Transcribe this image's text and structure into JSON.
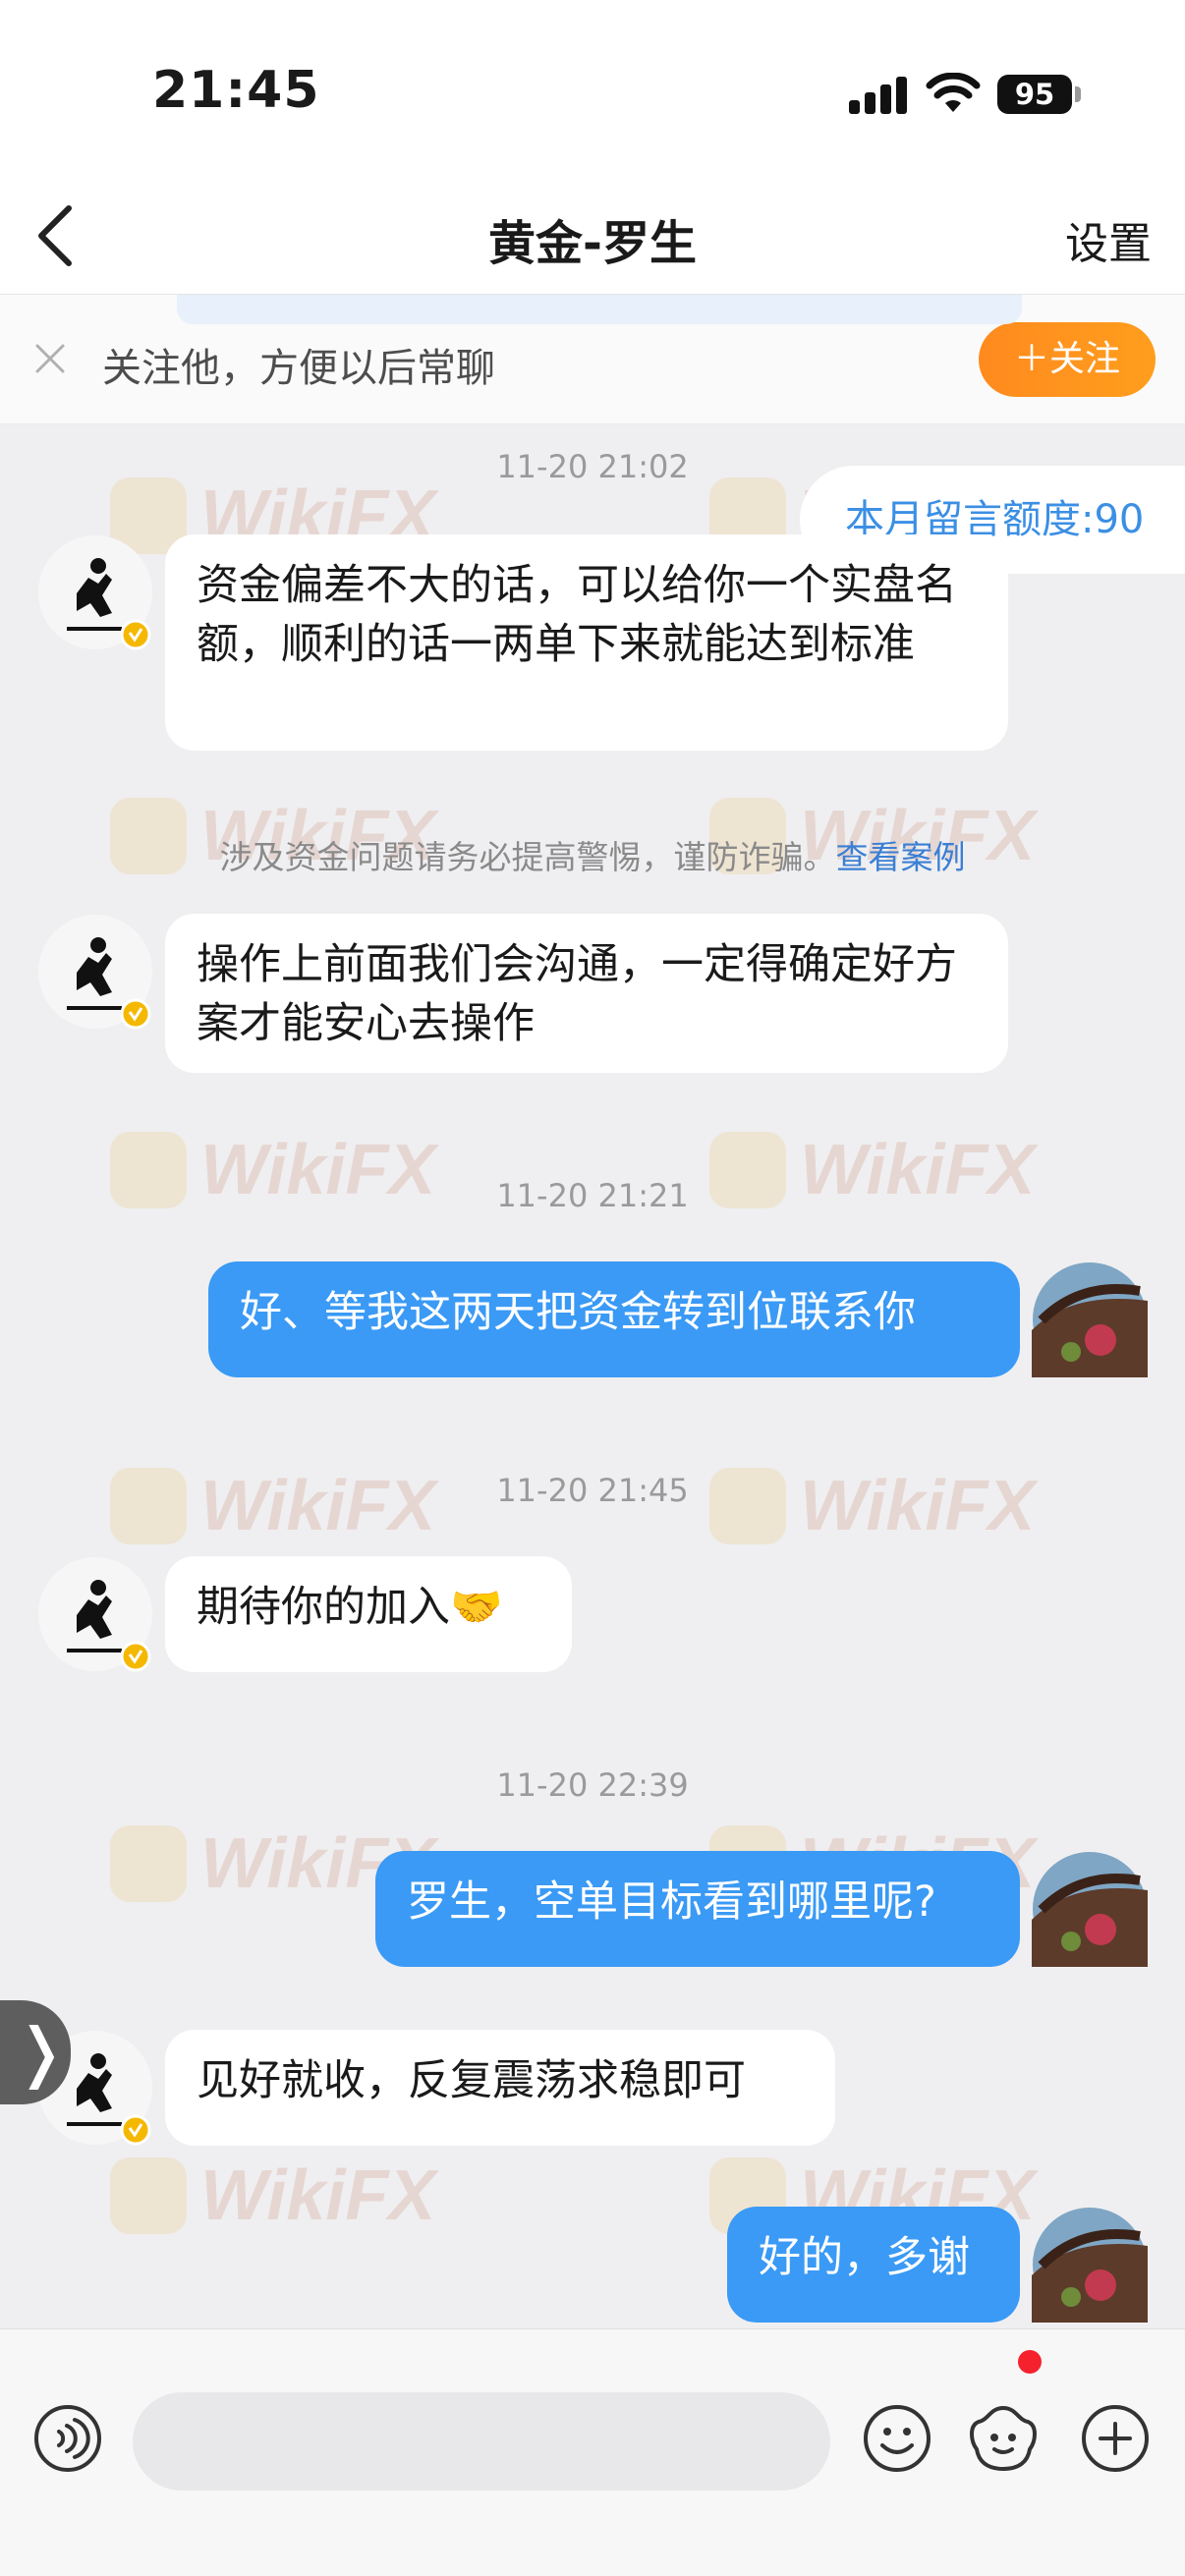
{
  "status_bar": {
    "time": "21:45",
    "battery": "95"
  },
  "nav": {
    "title": "黄金-罗生",
    "settings_label": "设置"
  },
  "follow_banner": {
    "text": "关注他，方便以后常聊",
    "button_label": "＋关注"
  },
  "quota": {
    "text": "本月留言额度:90"
  },
  "watermark": {
    "text": "WikiFX"
  },
  "messages": [
    {
      "type": "timestamp",
      "text": "11-20 21:02"
    },
    {
      "type": "in",
      "text": "资金偏差不大的话，可以给你一个实盘名额，顺利的话一两单下来就能达到标准"
    },
    {
      "type": "warning",
      "text": "涉及资金问题请务必提高警惕，谨防诈骗。",
      "link": "查看案例"
    },
    {
      "type": "in",
      "text": "操作上前面我们会沟通，一定得确定好方案才能安心去操作"
    },
    {
      "type": "timestamp",
      "text": "11-20 21:21"
    },
    {
      "type": "out",
      "text": "好、等我这两天把资金转到位联系你"
    },
    {
      "type": "timestamp",
      "text": "11-20 21:45"
    },
    {
      "type": "in",
      "text": "期待你的加入🤝"
    },
    {
      "type": "timestamp",
      "text": "11-20 22:39"
    },
    {
      "type": "out",
      "text": "罗生，空单目标看到哪里呢?"
    },
    {
      "type": "in",
      "text": "见好就收，反复震荡求稳即可"
    },
    {
      "type": "out",
      "text": "好的，多谢"
    }
  ],
  "side_handle": {
    "text": "❭"
  },
  "colors": {
    "accent_blue": "#3a9af5",
    "follow_orange": "#ff9e1d",
    "verified_gold": "#f5b800"
  }
}
